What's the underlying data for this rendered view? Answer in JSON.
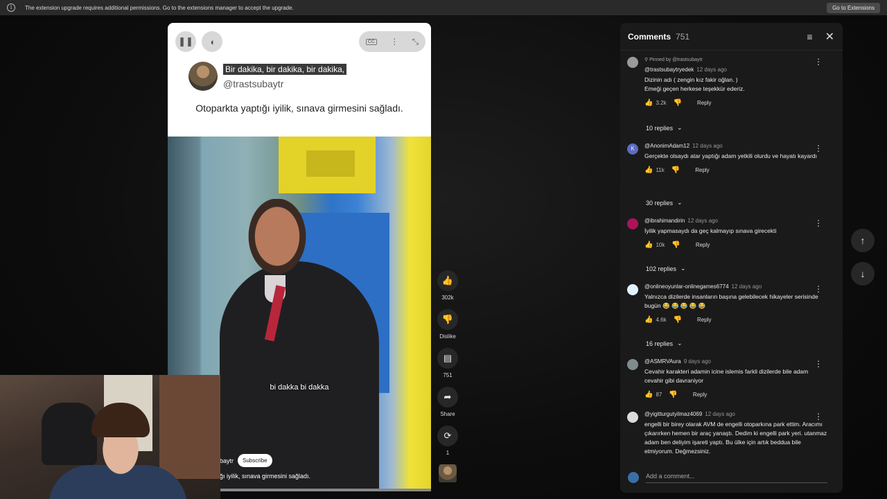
{
  "banner": {
    "icon": "info-icon",
    "message": "The extension upgrade requires additional permissions. Go to the extensions manager to accept the upgrade.",
    "button": "Go to Extensions"
  },
  "player": {
    "header_line1": "Bir dakika, bir dakika, bir dakika,",
    "handle": "@trastsubaytr",
    "caption": "Otoparkta yaptığı iyilik, sınava girmesini sağladı.",
    "subtitle": "bi dakka bi dakka",
    "channel_partial": "baytr",
    "subscribe": "Subscribe",
    "desc_partial": "ğı iyilik, sınava girmesini sağladı."
  },
  "actions": {
    "like_count": "302k",
    "dislike_label": "Dislike",
    "comments_count": "751",
    "share_label": "Share",
    "remix_count": "1"
  },
  "comments_panel": {
    "title": "Comments",
    "count": "751",
    "add_placeholder": "Add a comment...",
    "comments": [
      {
        "pinned": "Pinned by @trastsubaytr",
        "author": "@trastsubaytryedek",
        "time": "12 days ago",
        "text": "Dizinin adı (      zengin kız fakir oğlan.       )\nEmeği geçen herkese teşekkür ederiz.",
        "likes": "3.2k",
        "reply": "Reply",
        "replies": "10 replies",
        "avatar_color": "#9a9a9a"
      },
      {
        "pinned": "",
        "author": "@AnonimAdam12",
        "time": "12 days ago",
        "text": "Gerçekte olsaydı atar yaptığı adam yetkili olurdu ve hayatı kayardı",
        "likes": "11k",
        "reply": "Reply",
        "replies": "30 replies",
        "avatar_color": "#5c6bc0"
      },
      {
        "pinned": "",
        "author": "@ibrahimandirin",
        "time": "12 days ago",
        "text": "İyilik yapmasaydı da geç kalmayıp sınava girecekti",
        "likes": "10k",
        "reply": "Reply",
        "replies": "102 replies",
        "avatar_color": "#ad1457"
      },
      {
        "pinned": "",
        "author": "@onlineoyunlar-onlinegames6774",
        "time": "12 days ago",
        "text": "Yalnızca dizilerde insanların başına gelebilecek hikayeler serisinde bugün 😂 😂 😂 😂 😂",
        "likes": "4.6k",
        "reply": "Reply",
        "replies": "16 replies",
        "avatar_color": "#e0f2ff"
      },
      {
        "pinned": "",
        "author": "@ASMRVAura",
        "time": "9 days ago",
        "text": "Cevahir karakteri adamin icine islemis farkli dizilerde bile adam cevahir gibi davraniyor",
        "likes": "87",
        "reply": "Reply",
        "replies": "",
        "avatar_color": "#7f8c8d"
      },
      {
        "pinned": "",
        "author": "@yigitturgutyilmaz4069",
        "time": "12 days ago",
        "text": "engelli bir birey olarak AVM de engelli otoparkına park ettim. Aracımı çıkarırken hemen bir araç yanaştı. Dedim ki engelli park yeri. utanmaz adam ben deliyim işareti yaptı. Bu ülke için artık beddua bile etmiyorum. Değmezsiniz.",
        "likes": "",
        "reply": "",
        "replies": "",
        "avatar_color": "#dcdcdc"
      }
    ]
  }
}
